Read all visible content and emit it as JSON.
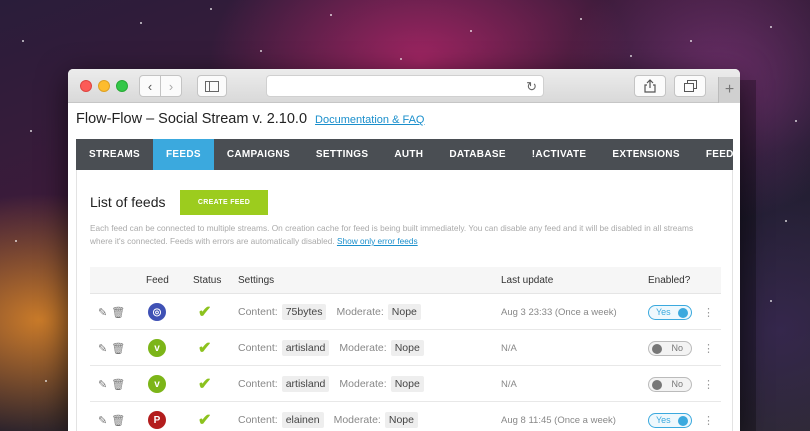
{
  "browser": {
    "url": "",
    "reload_icon": "reload-icon",
    "back_glyph": "‹",
    "forward_glyph": "›",
    "new_tab_glyph": "+"
  },
  "app": {
    "title": "Flow-Flow – Social Stream v. 2.10.0",
    "doc_link": "Documentation & FAQ"
  },
  "menu": {
    "items": [
      {
        "label": "STREAMS"
      },
      {
        "label": "FEEDS"
      },
      {
        "label": "CAMPAIGNS"
      },
      {
        "label": "SETTINGS"
      },
      {
        "label": "AUTH"
      },
      {
        "label": "DATABASE"
      },
      {
        "label": "!ACTIVATE"
      },
      {
        "label": "EXTENSIONS"
      },
      {
        "label": "FEEDBACK"
      }
    ],
    "active_index": 1,
    "active_color": "#3ba9de"
  },
  "feeds": {
    "title": "List of feeds",
    "create_button": "CREATE FEED",
    "description": "Each feed can be connected to multiple streams. On creation cache for feed is being built immediately. You can disable any feed and it will be disabled in all streams where it's connected. Feeds with errors are automatically disabled.",
    "error_link": "Show only error feeds",
    "columns": {
      "feed": "Feed",
      "status": "Status",
      "settings": "Settings",
      "last_update": "Last update",
      "enabled": "Enabled?"
    },
    "rows": [
      {
        "network": "instagram-icon",
        "glyph": "◎",
        "color": "#3f51b5",
        "status": "✔",
        "content_label": "Content:",
        "content": "75bytes",
        "moderate_label": "Moderate:",
        "moderate": "Nope",
        "last_update": "Aug 3 23:33 (Once a week)",
        "enabled": "Yes"
      },
      {
        "network": "vimeo-icon",
        "glyph": "v",
        "color": "#7cb518",
        "status": "✔",
        "content_label": "Content:",
        "content": "artisland",
        "moderate_label": "Moderate:",
        "moderate": "Nope",
        "last_update": "N/A",
        "enabled": "No"
      },
      {
        "network": "vimeo-icon",
        "glyph": "v",
        "color": "#7cb518",
        "status": "✔",
        "content_label": "Content:",
        "content": "artisland",
        "moderate_label": "Moderate:",
        "moderate": "Nope",
        "last_update": "N/A",
        "enabled": "No"
      },
      {
        "network": "pinterest-icon",
        "glyph": "P",
        "color": "#b31d1d",
        "status": "✔",
        "content_label": "Content:",
        "content": "elainen",
        "moderate_label": "Moderate:",
        "moderate": "Nope",
        "last_update": "Aug 8 11:45 (Once a week)",
        "enabled": "Yes"
      }
    ]
  }
}
